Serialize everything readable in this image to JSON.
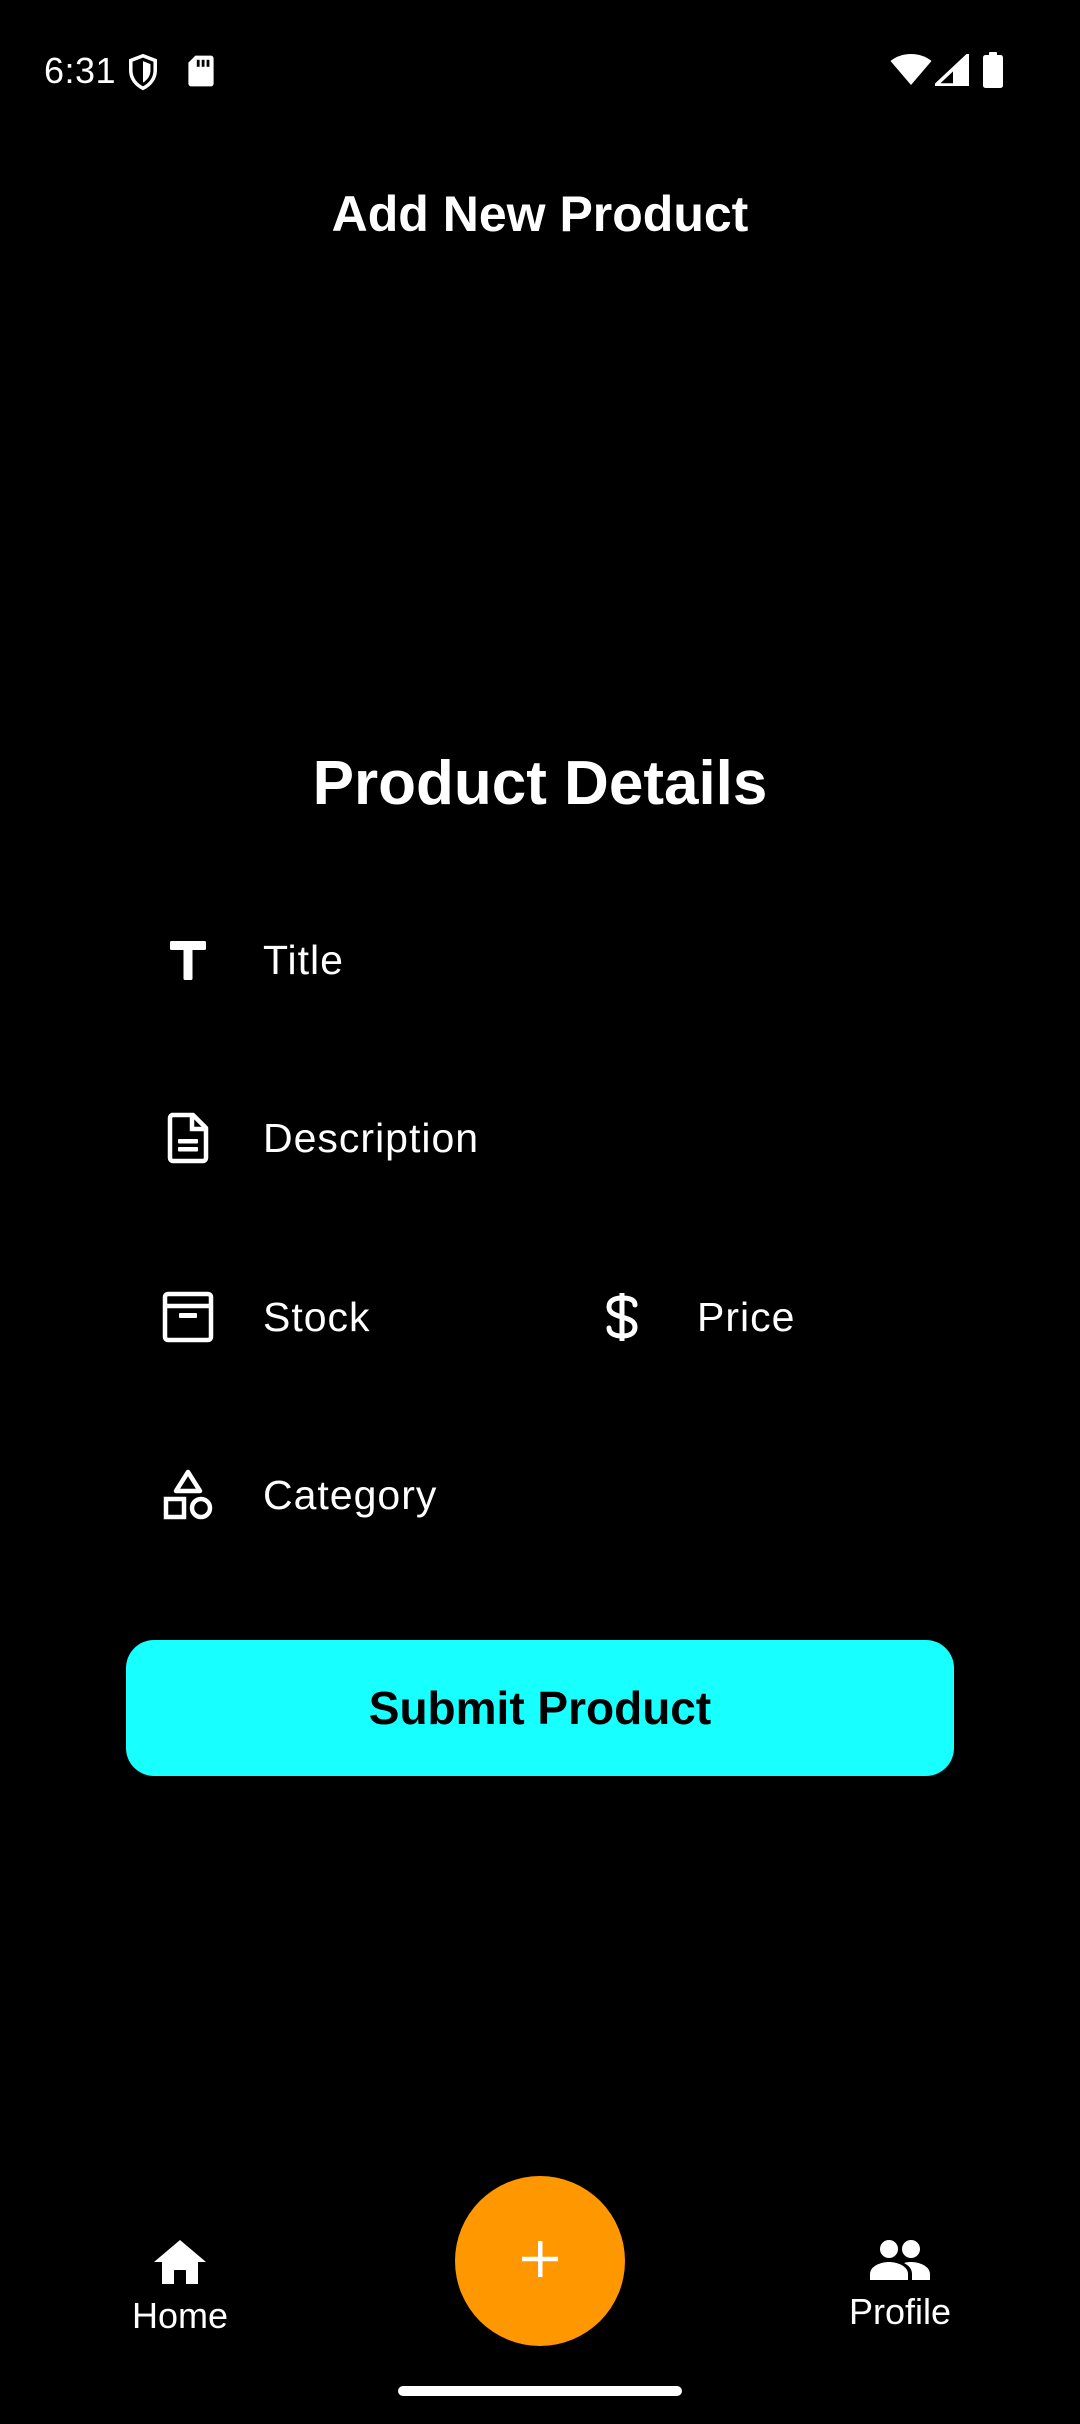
{
  "status_bar": {
    "time": "6:31",
    "icons": [
      "shield-icon",
      "sd-card-icon",
      "wifi-icon",
      "signal-icon",
      "battery-icon"
    ]
  },
  "header": {
    "title": "Add New Product"
  },
  "form": {
    "section_title": "Product Details",
    "fields": {
      "title": {
        "label": "Title",
        "icon": "text-t-icon"
      },
      "description": {
        "label": "Description",
        "icon": "document-icon"
      },
      "stock": {
        "label": "Stock",
        "icon": "archive-box-icon"
      },
      "price": {
        "label": "Price",
        "icon": "dollar-icon"
      },
      "category": {
        "label": "Category",
        "icon": "shapes-icon"
      }
    },
    "submit_label": "Submit Product"
  },
  "bottom_nav": {
    "home_label": "Home",
    "profile_label": "Profile",
    "fab_icon": "plus-icon"
  },
  "colors": {
    "background": "#000000",
    "text": "#ffffff",
    "submit_button": "#17ffff",
    "fab": "#ff9800"
  }
}
